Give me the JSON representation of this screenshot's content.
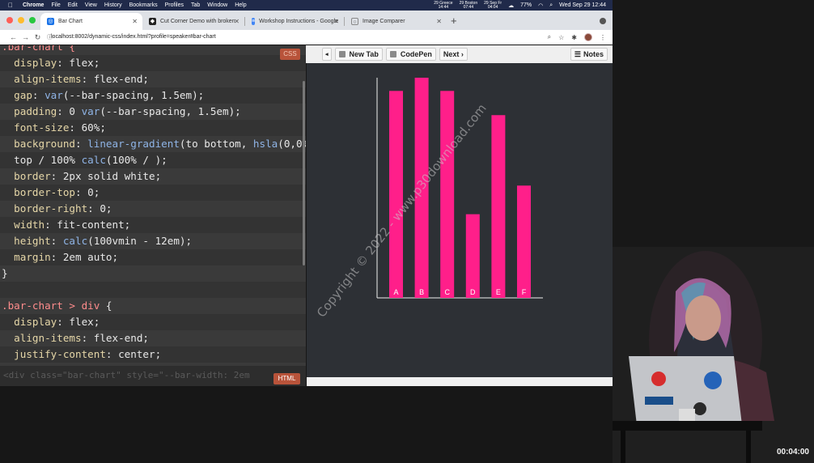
{
  "menubar": {
    "app": "Chrome",
    "items": [
      "File",
      "Edit",
      "View",
      "History",
      "Bookmarks",
      "Profiles",
      "Tab",
      "Window",
      "Help"
    ],
    "clocks": [
      {
        "line1": "29 Greece",
        "line2": "14:44"
      },
      {
        "line1": "29 Boston",
        "line2": "07:44"
      },
      {
        "line1": "29 Sep Fr",
        "line2": "04:04"
      }
    ],
    "battery": "77%",
    "datetime": "Wed Sep 29  12:44"
  },
  "tabs": [
    {
      "label": "Bar Chart",
      "active": true
    },
    {
      "label": "Cut Corner Demo with broken"
    },
    {
      "label": "Workshop Instructions - Google"
    },
    {
      "label": "Image Comparer"
    }
  ],
  "toolbar": {
    "url": "localhost:8002/dynamic-css/index.html?profile=speaker#bar-chart"
  },
  "editor": {
    "badge_css": "CSS",
    "badge_html": "HTML",
    "html_code": "<div class=\"bar-chart\" style=\"--bar-width: 2em"
  },
  "preview": {
    "new_tab": "New Tab",
    "codepen": "CodePen",
    "next": "Next ›",
    "notes": "Notes",
    "back": "◂"
  },
  "chart_data": {
    "type": "bar",
    "categories": [
      "A",
      "B",
      "C",
      "D",
      "E",
      "F"
    ],
    "values": [
      94,
      100,
      94,
      38,
      83,
      51
    ],
    "ylim": [
      0,
      100
    ],
    "color": "#ff1f8a"
  },
  "watermark": "Copyright © 2022 - www.p30download.com",
  "timer": "00:04:00"
}
